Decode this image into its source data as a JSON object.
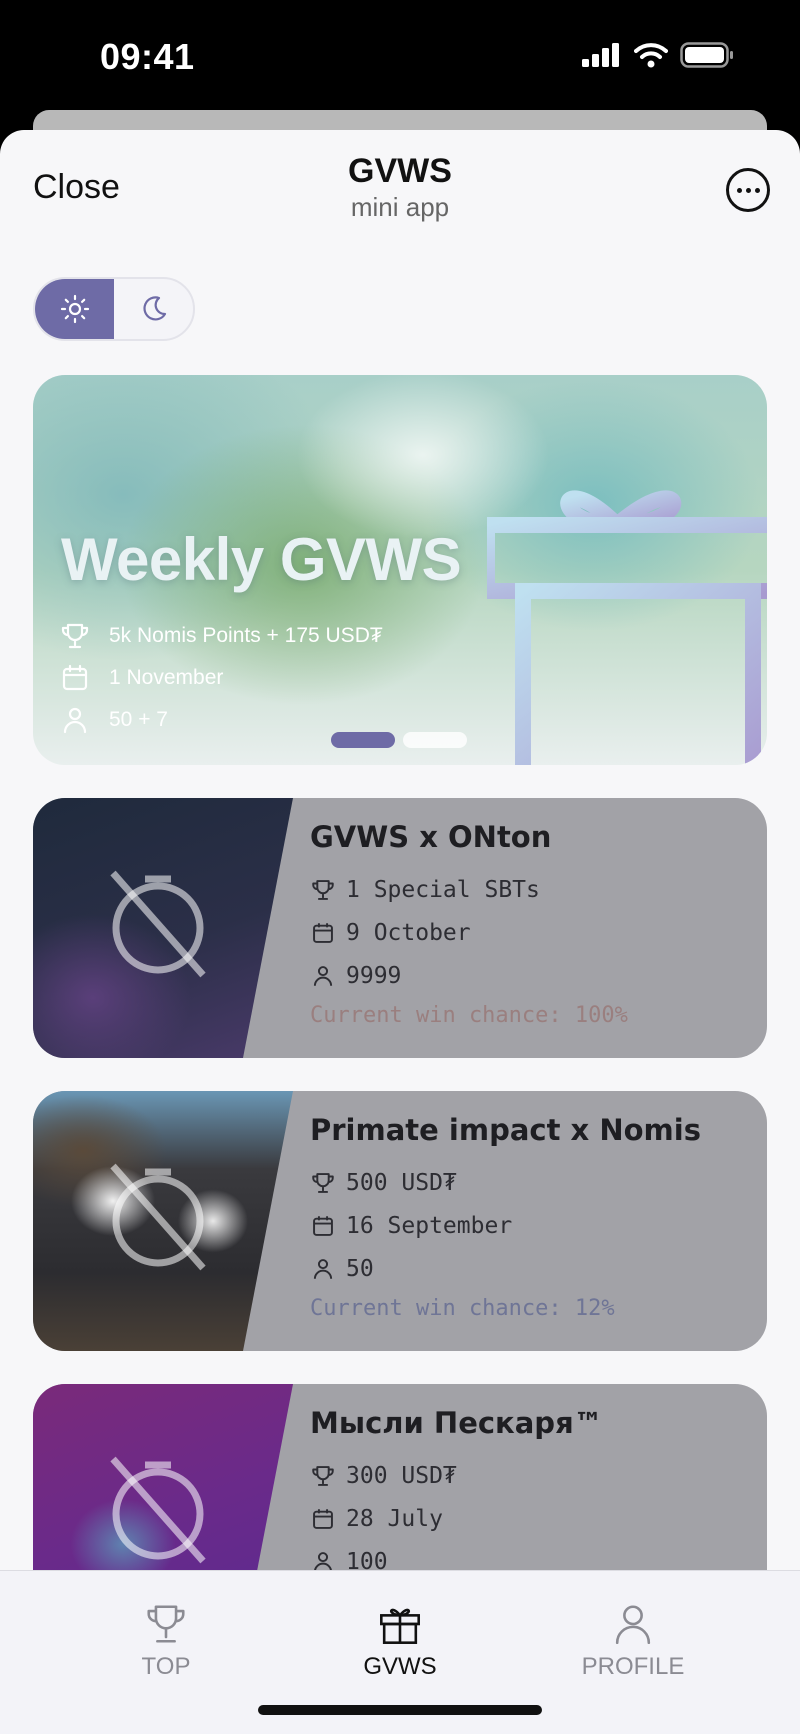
{
  "status_bar": {
    "time": "09:41"
  },
  "header": {
    "close_label": "Close",
    "title": "GVWS",
    "subtitle": "mini app"
  },
  "theme_toggle": {
    "options": [
      "light",
      "dark"
    ],
    "selected": "light"
  },
  "hero": {
    "title": "Weekly GVWS",
    "prize": "5k Nomis Points + 175 USD₮",
    "date": "1 November",
    "participants": "50 + 7",
    "carousel": {
      "total": 2,
      "current": 1
    }
  },
  "giveaways": [
    {
      "title": "GVWS x ONton",
      "prize": "1 Special SBTs",
      "date": "9 October",
      "participants": "9999",
      "chance": "Current win chance: 100%",
      "chance_color": "#9a7f7f"
    },
    {
      "title": "Primate impact x Nomis",
      "prize": "500 USD₮",
      "date": "16 September",
      "participants": "50",
      "chance": "Current win chance: 12%",
      "chance_color": "#6f7596"
    },
    {
      "title": "Мысли Пескаря™",
      "prize": "300 USD₮",
      "date": "28 July",
      "participants": "100",
      "chance": ""
    }
  ],
  "tabbar": {
    "tabs": [
      {
        "label": "TOP",
        "icon": "trophy-icon"
      },
      {
        "label": "GVWS",
        "icon": "gift-icon"
      },
      {
        "label": "PROFILE",
        "icon": "person-icon"
      }
    ],
    "active": "GVWS"
  },
  "colors": {
    "accent": "#6e6ba6",
    "card_bg": "#a2a2a7"
  }
}
